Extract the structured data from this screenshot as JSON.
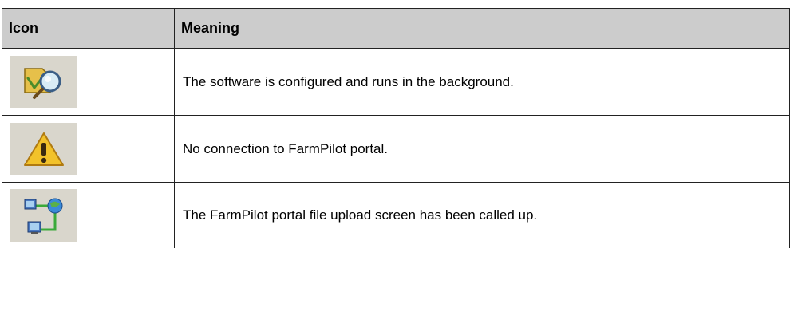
{
  "table": {
    "headers": {
      "icon": "Icon",
      "meaning": "Meaning"
    },
    "rows": [
      {
        "icon": "configured-background-icon",
        "meaning": "The software is configured and runs in the background."
      },
      {
        "icon": "warning-icon",
        "meaning": "No connection to FarmPilot portal."
      },
      {
        "icon": "network-upload-icon",
        "meaning": "The FarmPilot portal file upload screen has been called up."
      }
    ]
  },
  "colors": {
    "header_bg": "#cccccc",
    "icon_bg": "#d9d6cc",
    "border": "#222222"
  }
}
